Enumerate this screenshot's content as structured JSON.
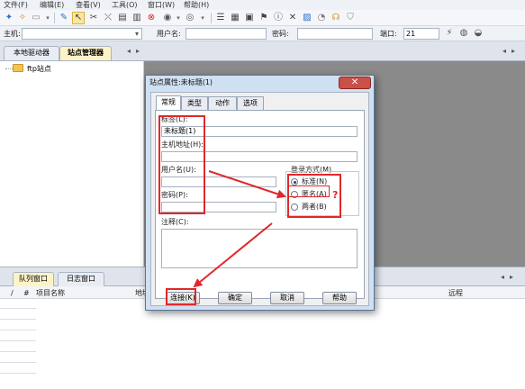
{
  "menu": [
    "文件(F)",
    "编辑(E)",
    "查看(V)",
    "工具(O)",
    "窗口(W)",
    "帮助(H)"
  ],
  "address_bar": {
    "host_label": "主机:",
    "host_value": "",
    "user_label": "用户名:",
    "user_value": "",
    "password_label": "密码:",
    "password_value": "",
    "port_label": "端口:",
    "port_value": "21"
  },
  "left_tabs": [
    "本地驱动器",
    "站点管理器"
  ],
  "tree": {
    "root_label": "ftp站点"
  },
  "bottom_tabs": [
    "队列窗口",
    "日志窗口"
  ],
  "list_columns": [
    "/",
    "#",
    "项目名称",
    "地址",
    "远程"
  ],
  "dialog": {
    "title": "站点属性:未标题(1)",
    "close_glyph": "✕",
    "tabs": [
      "常规",
      "类型",
      "动作",
      "选项"
    ],
    "fields": {
      "label_label": "标签(L):",
      "label_value": "未标题(1)",
      "host_label": "主机地址(H):",
      "user_label": "用户名(U):",
      "password_label": "密码(P):",
      "comment_label": "注释(C):"
    },
    "login_mode": {
      "title": "登录方式(M)",
      "options": [
        "标准(N)",
        "匿名(A)",
        "两者(B)"
      ],
      "selected": "标准(N)"
    },
    "buttons": {
      "connect": "连接(K)",
      "ok": "确定",
      "cancel": "取消",
      "help": "帮助"
    },
    "annotation_mark": "?"
  },
  "colors": {
    "highlight_red": "#e0282b",
    "dialog_frame": "#cfe0f2",
    "close_red": "#c95147"
  }
}
